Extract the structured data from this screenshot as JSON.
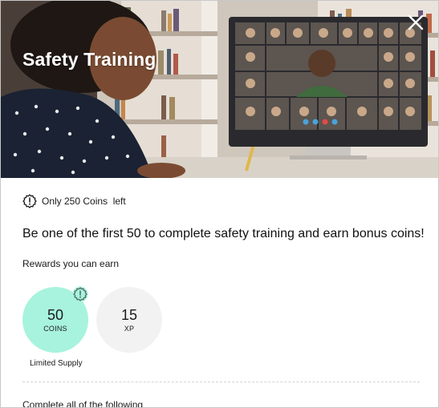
{
  "hero": {
    "title": "Safety Training",
    "close_icon": "close-icon"
  },
  "notice": {
    "icon": "warning-badge-icon",
    "text": "Only 250 Coins  left"
  },
  "headline": "Be one of the first 50 to complete safety training and earn bonus coins!",
  "rewards": {
    "section_label": "Rewards you can earn",
    "items": [
      {
        "value": "50",
        "unit": "COINS",
        "color": "#a8f3dd",
        "badge_icon": "warning-badge-icon",
        "caption": "Limited Supply"
      },
      {
        "value": "15",
        "unit": "XP",
        "color": "#f2f2f2"
      }
    ]
  },
  "tasks": {
    "label": "Complete all of the following"
  }
}
